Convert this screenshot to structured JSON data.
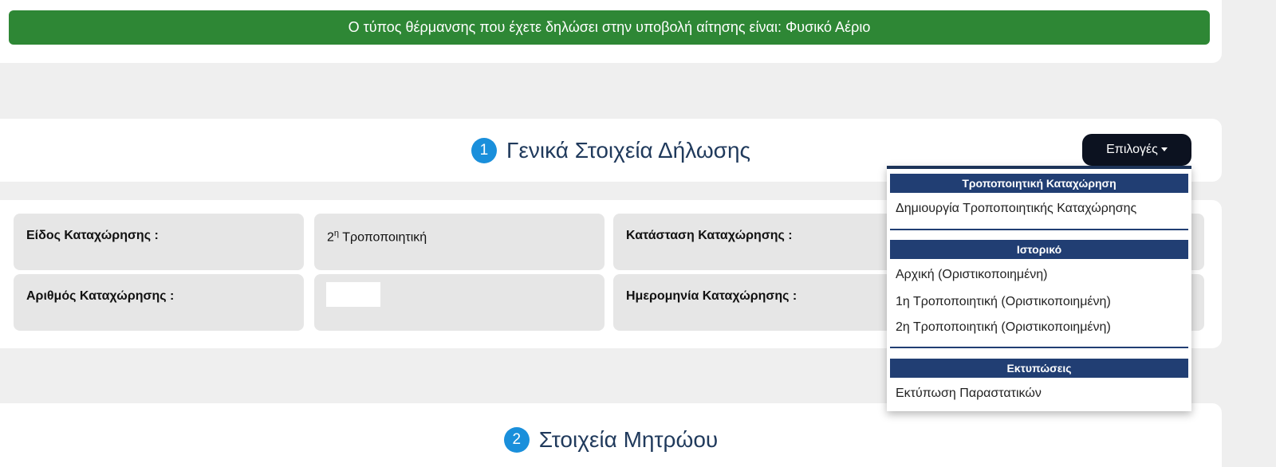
{
  "alert": {
    "message": "Ο τύπος θέρμανσης που έχετε δηλώσει στην υποβολή αίτησης είναι: Φυσικό Αέριο"
  },
  "section1": {
    "number": "1",
    "title": "Γενικά Στοιχεία Δήλωσης",
    "options_label": "Επιλογές"
  },
  "details": {
    "type_label": "Είδος Καταχώρησης :",
    "type_value_base": "2",
    "type_value_sup": "η",
    "type_value_text": " Τροποποιητική",
    "status_label": "Κατάσταση Καταχώρησης :",
    "number_label": "Αριθμός Καταχώρησης :",
    "date_label": "Ημερομηνία Καταχώρησης :"
  },
  "menu": {
    "group1_header": "Τροποποιητική Καταχώρηση",
    "group1_items": [
      "Δημιουργία Τροποποιητικής Καταχώρησης"
    ],
    "group2_header": "Ιστορικό",
    "group2_items": [
      "Αρχική (Οριστικοποιημένη)",
      "1η Τροποποιητική (Οριστικοποιημένη)",
      "2η Τροποποιητική (Οριστικοποιημένη)"
    ],
    "group3_header": "Εκτυπώσεις",
    "group3_items": [
      "Εκτύπωση Παραστατικών"
    ]
  },
  "section2": {
    "number": "2",
    "title": "Στοιχεία Μητρώου"
  },
  "colors": {
    "alert_green": "#2e8735",
    "badge_blue": "#1a8fdb",
    "menu_header_navy": "#213e73",
    "button_dark": "#0c1220"
  }
}
